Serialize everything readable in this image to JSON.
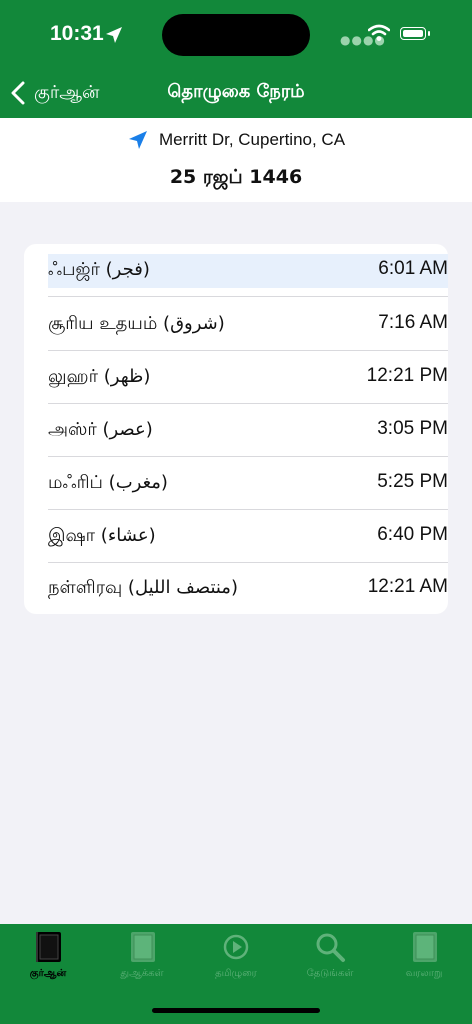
{
  "status_bar": {
    "time": "10:31"
  },
  "nav": {
    "back_label": "குர்ஆன்",
    "title": "தொழுகை நேரம்"
  },
  "location": {
    "text": "Merritt Dr, Cupertino, CA"
  },
  "hijri_date": "25 ரஜப் 1446",
  "prayers": [
    {
      "name": "ஃபஜ்ர் (فجر)",
      "time": "6:01 AM",
      "current": true
    },
    {
      "name": "சூரிய உதயம் (شروق)",
      "time": "7:16 AM"
    },
    {
      "name": "லுஹர் (ظهر)",
      "time": "12:21 PM"
    },
    {
      "name": "அஸ்ர் (عصر)",
      "time": "3:05 PM"
    },
    {
      "name": "மஃரிப் (مغرب)",
      "time": "5:25 PM"
    },
    {
      "name": "இஷா (عشاء)",
      "time": "6:40 PM"
    },
    {
      "name": "நள்ளிரவு (منتصف الليل)",
      "time": "12:21 AM"
    }
  ],
  "tabs": [
    {
      "label": "குர்ஆன்",
      "icon": "book-icon",
      "active": true
    },
    {
      "label": "துஆக்கள்",
      "icon": "book-icon"
    },
    {
      "label": "தமிழுரை",
      "icon": "play-circle-icon"
    },
    {
      "label": "தேடுங்கள்",
      "icon": "search-icon"
    },
    {
      "label": "வரலாறு",
      "icon": "book-icon"
    }
  ],
  "colors": {
    "brand_green": "#12883a",
    "accent_blue": "#1a7fe8",
    "highlight": "#e7f0fc"
  }
}
